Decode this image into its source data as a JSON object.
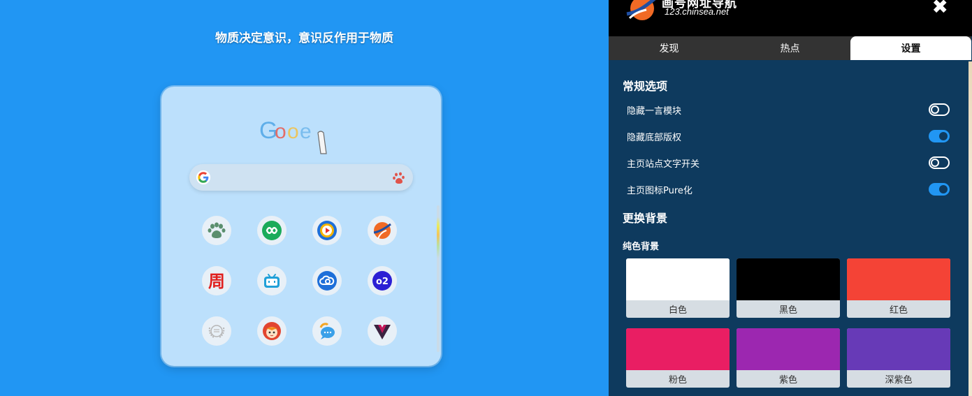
{
  "main": {
    "quote": "物质决定意识，意识反作用于物质",
    "sites": [
      {
        "icon": "baidu-paw-icon"
      },
      {
        "icon": "infinity-icon"
      },
      {
        "icon": "video-play-icon"
      },
      {
        "icon": "chinsea-logo-icon"
      },
      {
        "icon": "zhou-character-icon"
      },
      {
        "icon": "bilibili-tv-icon"
      },
      {
        "icon": "cloud-drive-icon"
      },
      {
        "icon": "o2-icon"
      },
      {
        "icon": "laurel-badge-icon"
      },
      {
        "icon": "anime-girl-icon"
      },
      {
        "icon": "chat-bubble-icon"
      },
      {
        "icon": "vue-v-icon"
      }
    ]
  },
  "panel": {
    "logo_title": "画号网址导航",
    "logo_url": "123.chinsea.net",
    "close": "✖",
    "tabs": [
      {
        "label": "发现",
        "active": false
      },
      {
        "label": "热点",
        "active": false
      },
      {
        "label": "设置",
        "active": true
      }
    ],
    "general_title": "常规选项",
    "options": [
      {
        "label": "隐藏一言模块",
        "on": false
      },
      {
        "label": "隐藏底部版权",
        "on": true
      },
      {
        "label": "主页站点文字开关",
        "on": false
      },
      {
        "label": "主页图标Pure化",
        "on": true
      }
    ],
    "bg_title": "更换背景",
    "solid_title": "纯色背景",
    "swatches": [
      {
        "label": "白色",
        "color": "#ffffff"
      },
      {
        "label": "黑色",
        "color": "#000000"
      },
      {
        "label": "红色",
        "color": "#f44336"
      },
      {
        "label": "粉色",
        "color": "#e91e63"
      },
      {
        "label": "紫色",
        "color": "#9c27b0"
      },
      {
        "label": "深紫色",
        "color": "#673ab7"
      }
    ]
  },
  "colors": {
    "page_bg": "#2196f3",
    "panel_bg": "#0e3a5e",
    "toggle_on": "#2196f3"
  }
}
